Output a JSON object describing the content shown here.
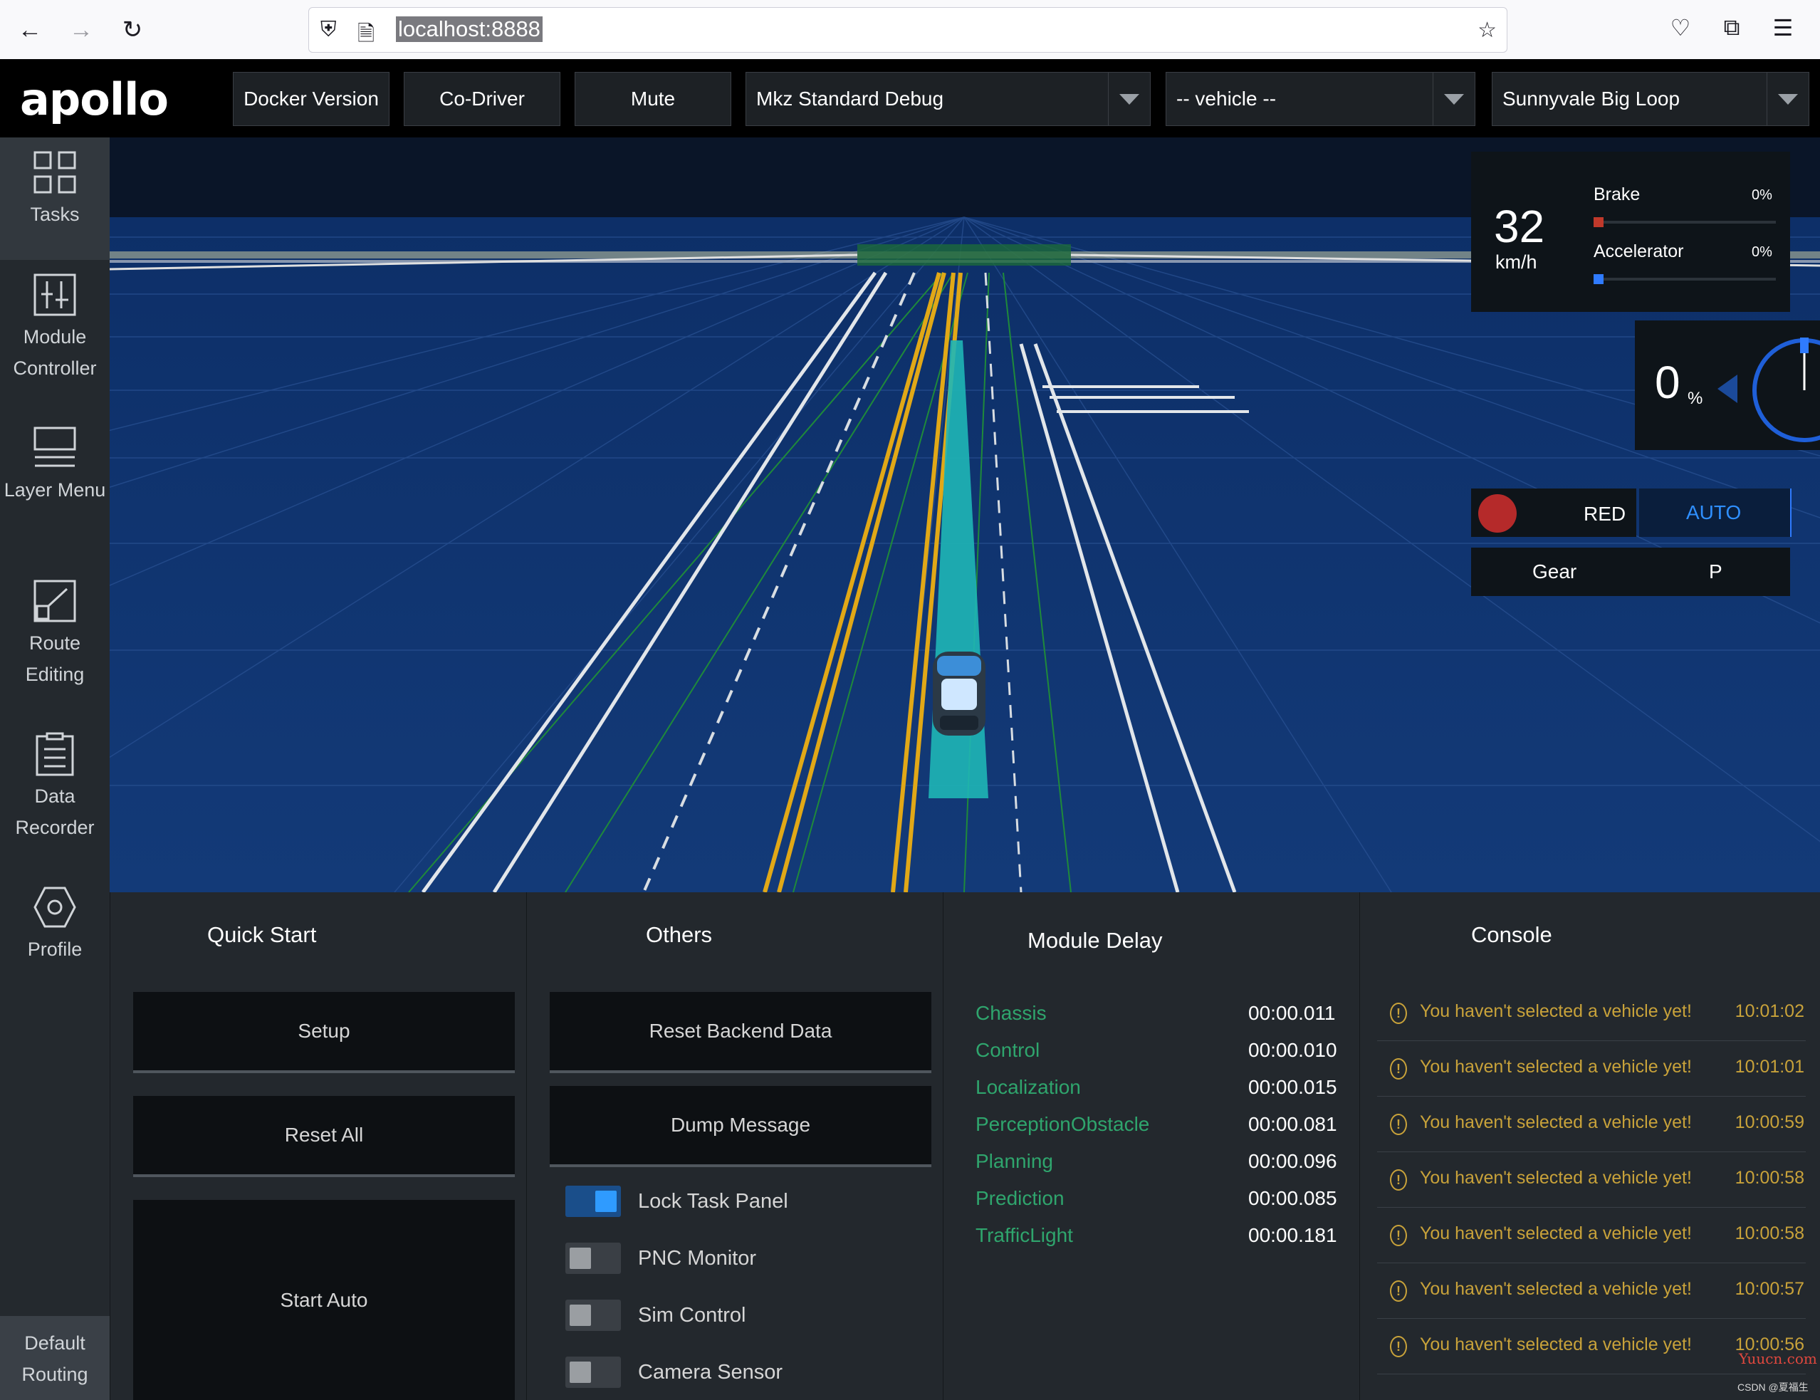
{
  "browser": {
    "url": "localhost:8888"
  },
  "header": {
    "logo": "apollo",
    "buttons": [
      "Docker Version",
      "Co-Driver",
      "Mute"
    ],
    "mode_select": "Mkz Standard Debug",
    "vehicle_select": "-- vehicle --",
    "map_select": "Sunnyvale Big Loop"
  },
  "sidebar": {
    "items": [
      {
        "label": "Tasks",
        "icon": "grid-icon"
      },
      {
        "label": "Module Controller",
        "icon": "module-controller-icon"
      },
      {
        "label": "Layer Menu",
        "icon": "layer-menu-icon"
      },
      {
        "label": "Route Editing",
        "icon": "route-editing-icon"
      },
      {
        "label": "Data Recorder",
        "icon": "data-recorder-icon"
      },
      {
        "label": "Profile",
        "icon": "hexagon-profile-icon"
      }
    ],
    "default_routing": "Default Routing"
  },
  "hud": {
    "speed": "32",
    "speed_unit": "km/h",
    "brake_label": "Brake",
    "brake_value": "0%",
    "brake_fraction": 0,
    "accel_label": "Accelerator",
    "accel_value": "0%",
    "accel_fraction": 0,
    "steering_value": "0",
    "steering_unit": "%",
    "traffic_light": "RED",
    "drive_mode": "AUTO",
    "gear_label": "Gear",
    "gear_value": "P",
    "colors": {
      "red_light": "#b52a2a",
      "auto": "#2f8fff"
    }
  },
  "quick_start": {
    "title": "Quick Start",
    "buttons": [
      "Setup",
      "Reset All",
      "Start Auto"
    ]
  },
  "others": {
    "title": "Others",
    "buttons": [
      "Reset Backend Data",
      "Dump Message"
    ],
    "toggles": [
      {
        "label": "Lock Task Panel",
        "on": true
      },
      {
        "label": "PNC Monitor",
        "on": false
      },
      {
        "label": "Sim Control",
        "on": false
      },
      {
        "label": "Camera Sensor",
        "on": false
      }
    ]
  },
  "module_delay": {
    "title": "Module Delay",
    "rows": [
      {
        "name": "Chassis",
        "value": "00:00.011"
      },
      {
        "name": "Control",
        "value": "00:00.010"
      },
      {
        "name": "Localization",
        "value": "00:00.015"
      },
      {
        "name": "PerceptionObstacle",
        "value": "00:00.081"
      },
      {
        "name": "Planning",
        "value": "00:00.096"
      },
      {
        "name": "Prediction",
        "value": "00:00.085"
      },
      {
        "name": "TrafficLight",
        "value": "00:00.181"
      }
    ]
  },
  "console": {
    "title": "Console",
    "messages": [
      {
        "text": "You haven't selected a vehicle yet!",
        "time": "10:01:02"
      },
      {
        "text": "You haven't selected a vehicle yet!",
        "time": "10:01:01"
      },
      {
        "text": "You haven't selected a vehicle yet!",
        "time": "10:00:59"
      },
      {
        "text": "You haven't selected a vehicle yet!",
        "time": "10:00:58"
      },
      {
        "text": "You haven't selected a vehicle yet!",
        "time": "10:00:58"
      },
      {
        "text": "You haven't selected a vehicle yet!",
        "time": "10:00:57"
      },
      {
        "text": "You haven't selected a vehicle yet!",
        "time": "10:00:56"
      }
    ]
  },
  "watermark": {
    "site": "Yuucn.com",
    "credit": "CSDN @夏福生"
  }
}
